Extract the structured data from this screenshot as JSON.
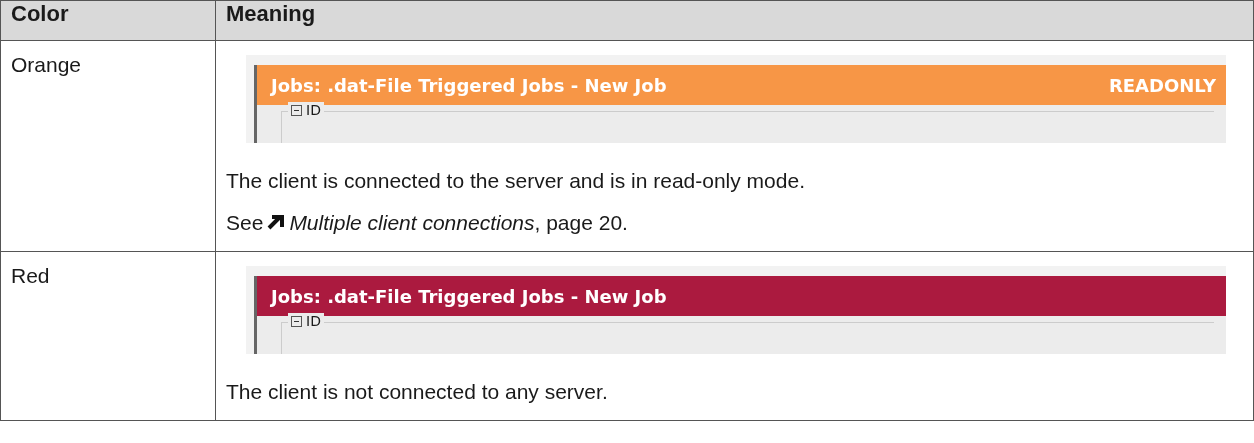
{
  "table": {
    "columns": [
      "Color",
      "Meaning"
    ],
    "rows": [
      {
        "color_label": "Orange",
        "screenshot": {
          "color": "#f79646",
          "title": "Jobs: .dat-File Triggered Jobs - New Job",
          "badge": "READONLY",
          "group": "ID"
        },
        "paragraphs": [
          {
            "kind": "plain",
            "text": "The client is connected to the server and is in read-only mode."
          },
          {
            "kind": "reference",
            "prefix": "See",
            "link": "Multiple client connections",
            "suffix": ", page 20."
          }
        ]
      },
      {
        "color_label": "Red",
        "screenshot": {
          "color": "#ab1a3f",
          "title": "Jobs: .dat-File Triggered Jobs - New Job",
          "group": "ID"
        },
        "paragraphs": [
          {
            "kind": "plain",
            "text": "The client is not connected to any server."
          }
        ]
      }
    ]
  }
}
